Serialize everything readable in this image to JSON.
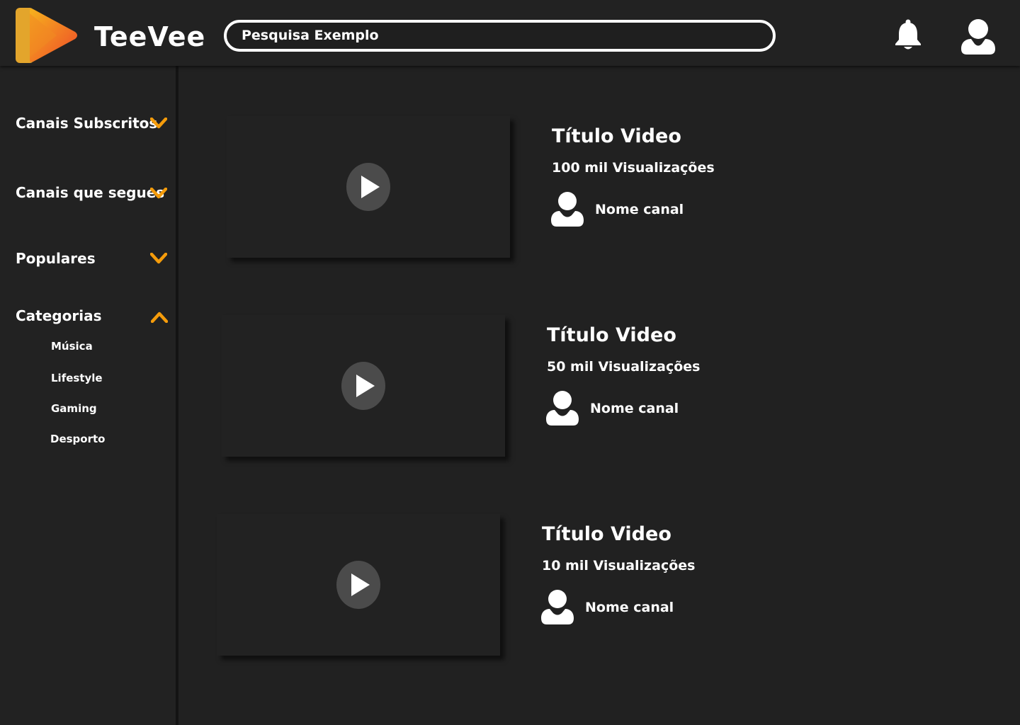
{
  "app": {
    "name": "TeeVee",
    "accent_color": "#f59c0b",
    "logo_colors": [
      "#e7a62b",
      "#f6ad1e",
      "#ee4a29"
    ]
  },
  "header": {
    "search_value": "Pesquisa Exemplo",
    "notification_icon": "bell-icon",
    "profile_icon": "user-icon"
  },
  "sidebar": {
    "items": [
      {
        "label": "Canais Subscritos",
        "state": "collapsed",
        "icon": "chevron-down-icon"
      },
      {
        "label": "Canais que segues",
        "state": "collapsed",
        "icon": "chevron-down-icon"
      },
      {
        "label": "Populares",
        "state": "collapsed",
        "icon": "chevron-down-icon"
      },
      {
        "label": "Categorias",
        "state": "expanded",
        "icon": "chevron-up-icon"
      }
    ],
    "categories": [
      "Música",
      "Lifestyle",
      "Gaming",
      "Desporto"
    ]
  },
  "videos": [
    {
      "title": "Título Video",
      "views": "100 mil Visualizações",
      "channel": "Nome canal"
    },
    {
      "title": "Título Video",
      "views": "50 mil Visualizações",
      "channel": "Nome canal"
    },
    {
      "title": "Título Video",
      "views": "10 mil Visualizações",
      "channel": "Nome canal"
    }
  ]
}
